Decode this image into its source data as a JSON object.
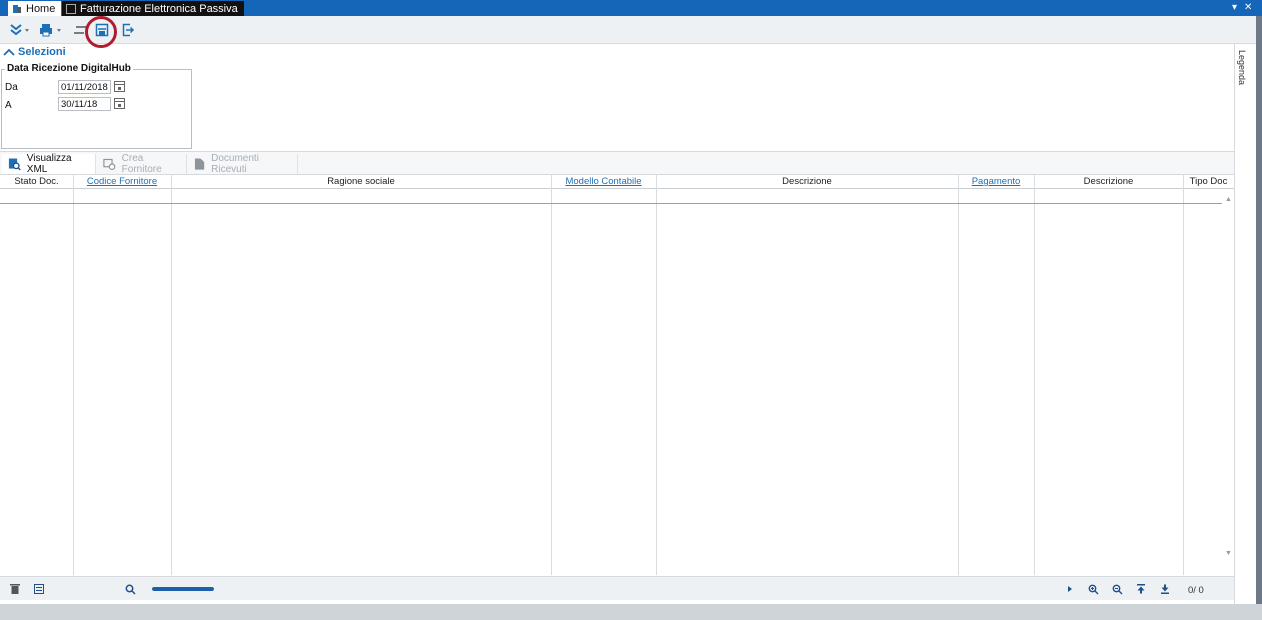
{
  "tabs": {
    "home_label": "Home",
    "active_label": "Fatturazione Elettronica Passiva"
  },
  "window_controls": {
    "dropdown": "▾",
    "close": "✕"
  },
  "toolbar": {
    "icons": [
      "double-chevron-down-icon",
      "print-icon",
      "align-icon",
      "save-icon",
      "exit-icon"
    ]
  },
  "legend": {
    "label": "Legenda"
  },
  "selection": {
    "header": "Selezioni",
    "group_title": "Data Ricezione DigitalHub",
    "from_label": "Da",
    "from_value": "01/11/2018",
    "to_label": "A",
    "to_value": "30/11/18"
  },
  "actions": {
    "view_xml": "Visualizza XML",
    "create_supplier": "Crea Fornitore",
    "received_docs": "Documenti Ricevuti"
  },
  "grid": {
    "columns": [
      {
        "label": "Stato Doc.",
        "link": false
      },
      {
        "label": "Codice Fornitore",
        "link": true
      },
      {
        "label": "Ragione sociale",
        "link": false
      },
      {
        "label": "Modello Contabile",
        "link": true
      },
      {
        "label": "Descrizione",
        "link": false
      },
      {
        "label": "Pagamento",
        "link": true
      },
      {
        "label": "Descrizione",
        "link": false
      },
      {
        "label": "Tipo Doc",
        "link": false
      }
    ]
  },
  "footer": {
    "counter": "0/  0",
    "progress": 1.0
  },
  "colors": {
    "titlebar": "#1565b8",
    "accent": "#1d6fb8",
    "highlight_ring": "#b01c2e",
    "progress": "#1d5fa8"
  }
}
